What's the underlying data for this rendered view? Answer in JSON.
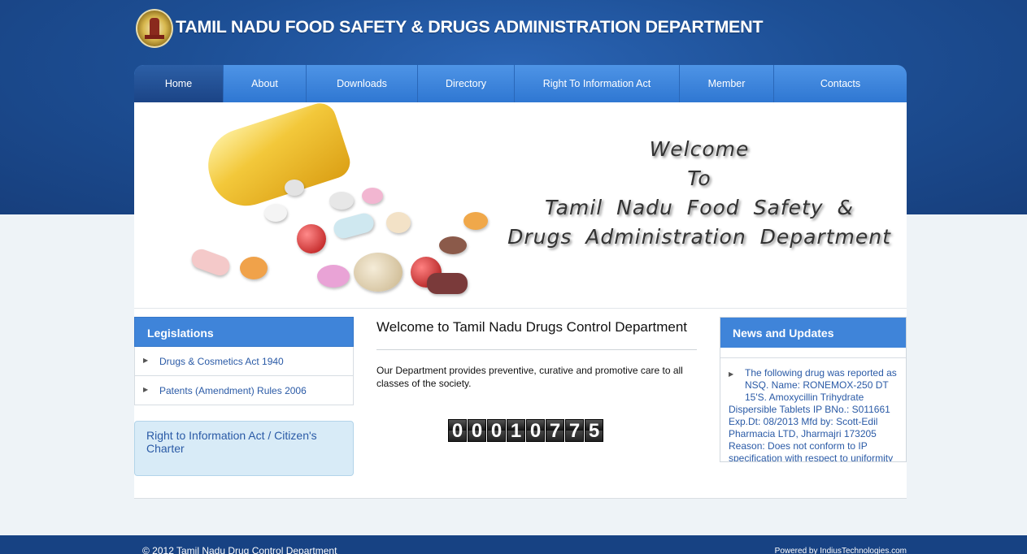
{
  "header": {
    "title": "TAMIL NADU FOOD SAFETY & DRUGS ADMINISTRATION DEPARTMENT",
    "logo_icon": "state-emblem-icon"
  },
  "nav": {
    "items": [
      {
        "label": "Home",
        "active": true
      },
      {
        "label": "About"
      },
      {
        "label": "Downloads"
      },
      {
        "label": "Directory"
      },
      {
        "label": "Right To Information Act"
      },
      {
        "label": "Member"
      },
      {
        "label": "Contacts"
      }
    ]
  },
  "banner": {
    "line1": "Welcome",
    "line2": "To",
    "line3": "Tamil Nadu Food Safety &",
    "line4": "Drugs Administration Department"
  },
  "legislations": {
    "title": "Legislations",
    "items": [
      {
        "label": "Drugs & Cosmetics Act 1940"
      },
      {
        "label": "Patents (Amendment) Rules 2006"
      }
    ]
  },
  "rti": {
    "label": "Right to Information Act / Citizen's Charter"
  },
  "main": {
    "heading": "Welcome to Tamil Nadu Drugs Control Department",
    "text": "Our Department provides preventive, curative and promotive care to all classes of the society.",
    "counter_digits": [
      "0",
      "0",
      "0",
      "1",
      "0",
      "7",
      "7",
      "5"
    ]
  },
  "news": {
    "title": "News and Updates",
    "item_first_lines": "The following drug was reported as NSQ. Name: RONEMOX-250 DT 15'S. Amoxycillin Trihydrate",
    "item_rest": "Dispersible Tablets IP BNo.: S011661 Exp.Dt: 08/2013 Mfd by: Scott-Edil Pharmacia LTD, Jharmajri 173205 Reason: Does not conform to IP specification with respect to uniformity"
  },
  "footer": {
    "copyright": "© 2012 Tamil Nadu Drug Control Department",
    "powered": "Powered by IndiusTechnologies.com"
  },
  "colors": {
    "header_blue": "#1d4f95",
    "nav_blue": "#3f84d9",
    "link_blue": "#2a5aa6",
    "footer_blue": "#174283"
  }
}
